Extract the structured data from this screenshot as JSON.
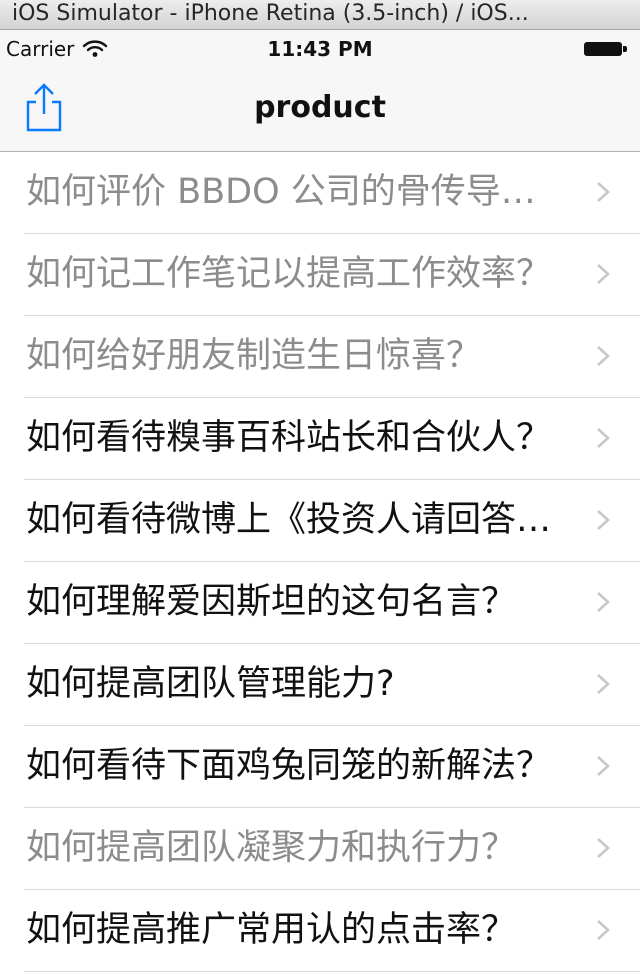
{
  "window": {
    "title": "iOS Simulator - iPhone Retina (3.5-inch) / iOS..."
  },
  "status_bar": {
    "carrier": "Carrier",
    "time": "11:43 PM"
  },
  "nav_bar": {
    "title": "product",
    "share_icon": "share-icon"
  },
  "list": {
    "items": [
      {
        "title": "如何评价 BBDO 公司的骨传导广告？",
        "visited": true
      },
      {
        "title": "如何记工作笔记以提高工作效率？",
        "visited": true
      },
      {
        "title": "如何给好朋友制造生日惊喜？",
        "visited": true
      },
      {
        "title": "如何看待糗事百科站长和合伙人？",
        "visited": false
      },
      {
        "title": "如何看待微博上《投资人请回答》？",
        "visited": false
      },
      {
        "title": "如何理解爱因斯坦的这句名言？",
        "visited": false
      },
      {
        "title": "如何提高团队管理能力?",
        "visited": false
      },
      {
        "title": "如何看待下面鸡兔同笼的新解法？",
        "visited": false
      },
      {
        "title": "如何提高团队凝聚力和执行力？",
        "visited": true
      },
      {
        "title": "如何提高推广常用认的点击率？",
        "visited": false
      }
    ]
  },
  "colors": {
    "accent": "#0a7aff",
    "text": "#111111",
    "visited_text": "#8c8c8c",
    "separator": "#d9d9d9",
    "chevron": "#c7c7cc"
  }
}
